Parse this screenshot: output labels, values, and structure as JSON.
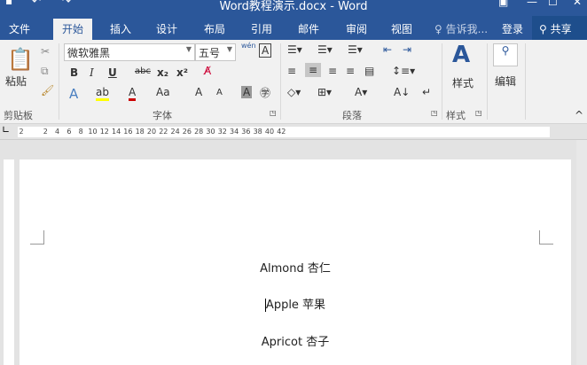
{
  "title": "Word教程演示.docx - Word",
  "tabs": [
    "文件",
    "开始",
    "插入",
    "设计",
    "布局",
    "引用",
    "邮件",
    "审阅",
    "视图"
  ],
  "tell_me": "告诉我...",
  "login": "登录",
  "share": "共享",
  "clipboard": {
    "paste": "粘贴",
    "label": "剪贴板"
  },
  "font": {
    "name": "微软雅黑",
    "size": "五号",
    "label": "字体",
    "bold": "B",
    "italic": "I",
    "underline": "U",
    "strike": "abc",
    "sub": "x₂",
    "sup": "x²",
    "case": "Aa",
    "grow": "A",
    "shrink": "A",
    "wen": "wén"
  },
  "paragraph": {
    "label": "段落"
  },
  "styles": {
    "button": "样式",
    "label": "样式"
  },
  "editing": {
    "button": "编辑"
  },
  "ruler": [
    "2",
    "2",
    "4",
    "6",
    "8",
    "10",
    "12",
    "14",
    "16",
    "18",
    "20",
    "22",
    "24",
    "26",
    "28",
    "30",
    "32",
    "34",
    "36",
    "38",
    "40",
    "42"
  ],
  "document": {
    "lines": [
      "Almond 杏仁",
      "Apple 苹果",
      "Apricot 杏子"
    ]
  }
}
